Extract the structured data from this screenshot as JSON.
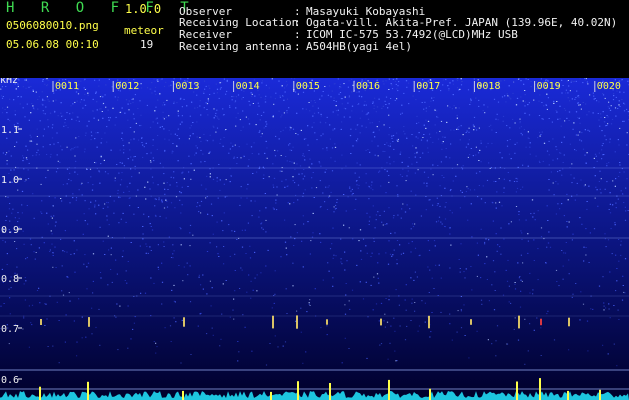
{
  "header": {
    "app_name": "H R O F F T",
    "version": "1.0.0",
    "filename": "0506080010.png",
    "datetime": "05.06.08 00:10",
    "meteor_label": "meteor",
    "meteor_count": "19"
  },
  "info": {
    "rows": [
      {
        "key": "Observer",
        "sep": ":",
        "value": "Masayuki Kobayashi"
      },
      {
        "key": "Receiving Location",
        "sep": ":",
        "value": "Ogata-vill. Akita-Pref. JAPAN (139.96E, 40.02N)"
      },
      {
        "key": "Receiver",
        "sep": ":",
        "value": "ICOM IC-575 53.7492(@LCD)MHz USB"
      },
      {
        "key": "Receiving antenna",
        "sep": ":",
        "value": "A504HB(yagi 4el)"
      }
    ]
  },
  "spectrogram": {
    "unit_label": "kHz",
    "y_ticks": [
      "1.1",
      "1.0",
      "0.9",
      "0.8",
      "0.7",
      "0.6"
    ],
    "time_ticks": [
      "0011",
      "0012",
      "0013",
      "0014",
      "0015",
      "0016",
      "0017",
      "0018",
      "0019",
      "0020"
    ],
    "colors": {
      "background": "#00003a",
      "noise": "#3246ff",
      "ticks": "#ffff4a",
      "baseline": "#22e8ff",
      "meteor": "#ff4040"
    }
  }
}
